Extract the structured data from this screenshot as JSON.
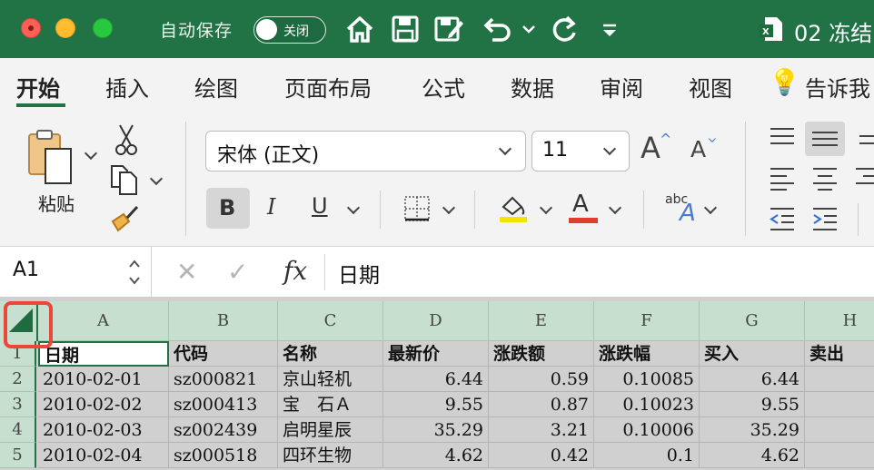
{
  "titlebar": {
    "autosave_label": "自动保存",
    "autosave_state": "关闭",
    "doc_title": "02 冻结",
    "icons": [
      "home-icon",
      "save-icon",
      "save-as-icon",
      "undo-icon",
      "redo-icon",
      "customize-icon"
    ]
  },
  "ribbon_tabs": [
    "开始",
    "插入",
    "绘图",
    "页面布局",
    "公式",
    "数据",
    "审阅",
    "视图",
    "告诉我"
  ],
  "home": {
    "paste_label": "粘贴",
    "font_name": "宋体 (正文)",
    "font_size": "11",
    "bold_label": "B",
    "italic_label": "I",
    "underline_label": "U",
    "grow_font": "A",
    "shrink_font": "A",
    "font_color_label": "A",
    "highlight_color": "#f5e400",
    "font_color": "#e03c31",
    "text_effect_label": "abc"
  },
  "formula_bar": {
    "name_box": "A1",
    "fx": "fx",
    "content": "日期"
  },
  "sheet": {
    "columns": [
      "A",
      "B",
      "C",
      "D",
      "E",
      "F",
      "G",
      "H"
    ],
    "row_numbers": [
      "1",
      "2",
      "3",
      "4",
      "5"
    ],
    "header": [
      "日期",
      "代码",
      "名称",
      "最新价",
      "涨跌额",
      "涨跌幅",
      "买入",
      "卖出"
    ],
    "rows": [
      [
        "2010-02-01",
        "sz000821",
        "京山轻机",
        "6.44",
        "0.59",
        "0.10085",
        "6.44",
        ""
      ],
      [
        "2010-02-02",
        "sz000413",
        "宝　石Ａ",
        "9.55",
        "0.87",
        "0.10023",
        "9.55",
        ""
      ],
      [
        "2010-02-03",
        "sz002439",
        "启明星辰",
        "35.29",
        "3.21",
        "0.10006",
        "35.29",
        ""
      ],
      [
        "2010-02-04",
        "sz000518",
        "四环生物",
        "4.62",
        "0.42",
        "0.1",
        "4.62",
        ""
      ]
    ],
    "accent": "#217346"
  }
}
